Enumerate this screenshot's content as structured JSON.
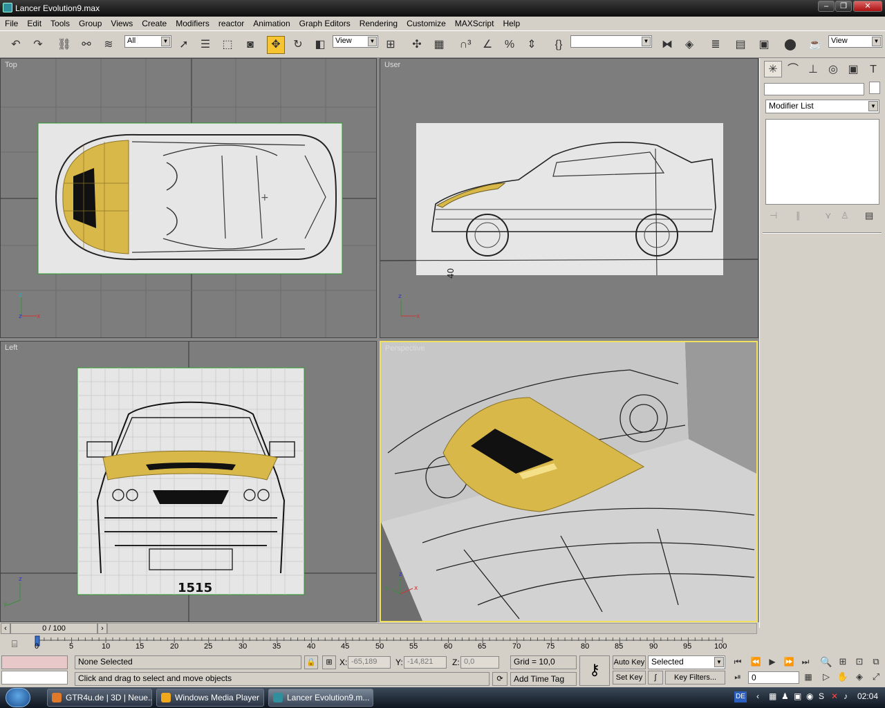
{
  "window": {
    "title": "Lancer Evolution9.max"
  },
  "menu": [
    "File",
    "Edit",
    "Tools",
    "Group",
    "Views",
    "Create",
    "Modifiers",
    "reactor",
    "Animation",
    "Graph Editors",
    "Rendering",
    "Customize",
    "MAXScript",
    "Help"
  ],
  "toolbar": {
    "selection_filter": "All",
    "ref_coord": "View",
    "named_sel": "",
    "ref_coord2": "View",
    "icons": [
      "undo-icon",
      "redo-icon",
      "select-link-icon",
      "unlink-icon",
      "bind-spacewarp-icon",
      "select-icon",
      "select-by-name-icon",
      "rect-region-icon",
      "window-crossing-icon",
      "move-icon",
      "rotate-icon",
      "scale-icon",
      "pivot-icon",
      "manipulate-icon",
      "snap-3d-icon",
      "angle-snap-icon",
      "percent-snap-icon",
      "spinner-snap-icon",
      "named-sel-edit-icon",
      "mirror-icon",
      "align-icon",
      "layer-icon",
      "curve-editor-icon",
      "schematic-icon",
      "material-editor-icon",
      "render-scene-icon"
    ]
  },
  "viewports": {
    "top": "Top",
    "user": "User",
    "left": "Left",
    "perspective": "Perspective"
  },
  "viewport_text": {
    "user_dim": "40",
    "left_dim": "1515"
  },
  "command_panel": {
    "tabs": [
      "create-icon",
      "modify-icon",
      "hierarchy-icon",
      "motion-icon",
      "display-icon",
      "utilities-icon"
    ],
    "name_value": "",
    "modifier_list": "Modifier List"
  },
  "timeline": {
    "frame": "0 / 100",
    "ticks": [
      "0",
      "5",
      "10",
      "15",
      "20",
      "25",
      "30",
      "35",
      "40",
      "45",
      "50",
      "55",
      "60",
      "65",
      "70",
      "75",
      "80",
      "85",
      "90",
      "95",
      "100"
    ]
  },
  "status": {
    "selection": "None Selected",
    "prompt": "Click and drag to select and move objects",
    "x_label": "X:",
    "x_value": "-65,189",
    "y_label": "Y:",
    "y_value": "-14,821",
    "z_label": "Z:",
    "z_value": "0,0",
    "grid": "Grid = 10,0",
    "add_time_tag": "Add Time Tag",
    "auto_key": "Auto Key",
    "set_key": "Set Key",
    "key_mode": "Selected",
    "key_filters": "Key Filters...",
    "current_frame": "0"
  },
  "taskbar": {
    "items": [
      "GTR4u.de | 3D | Neue...",
      "Windows Media Player",
      "Lancer Evolution9.m..."
    ],
    "lang": "DE",
    "clock": "02:04"
  },
  "colors": {
    "hood": "#d9b84a",
    "active_viewport": "#f2e15c",
    "viewport_bg": "#7d7d7d",
    "selection_box": "#2e9a2e"
  }
}
